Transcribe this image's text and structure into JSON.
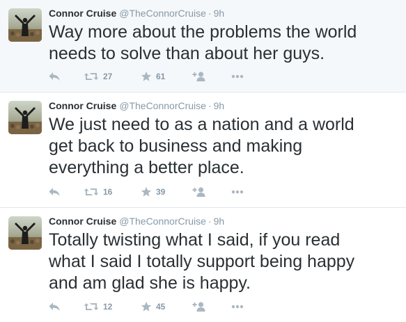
{
  "colors": {
    "muted": "#8899a6",
    "text": "#292f33",
    "hover_bg": "#f5f8fa",
    "divider": "#e1e8ed"
  },
  "tweets": [
    {
      "name": "Connor Cruise",
      "handle": "@TheConnorCruise",
      "separator": "·",
      "time": "9h",
      "text": "Way more about the problems the world\nneeds to solve than about her guys.",
      "retweets": "27",
      "favorites": "61",
      "icons": [
        "reply-icon",
        "retweet-icon",
        "favorite-icon",
        "follow-icon",
        "more-icon"
      ]
    },
    {
      "name": "Connor Cruise",
      "handle": "@TheConnorCruise",
      "separator": "·",
      "time": "9h",
      "text": "We just need to as a nation and a world\nget back to business and making\neverything a better place.",
      "retweets": "16",
      "favorites": "39",
      "icons": [
        "reply-icon",
        "retweet-icon",
        "favorite-icon",
        "follow-icon",
        "more-icon"
      ]
    },
    {
      "name": "Connor Cruise",
      "handle": "@TheConnorCruise",
      "separator": "·",
      "time": "9h",
      "text": "Totally twisting what I said, if you read\nwhat I said I totally support being happy\nand am glad she is happy.",
      "retweets": "12",
      "favorites": "45",
      "icons": [
        "reply-icon",
        "retweet-icon",
        "favorite-icon",
        "follow-icon",
        "more-icon"
      ]
    }
  ]
}
